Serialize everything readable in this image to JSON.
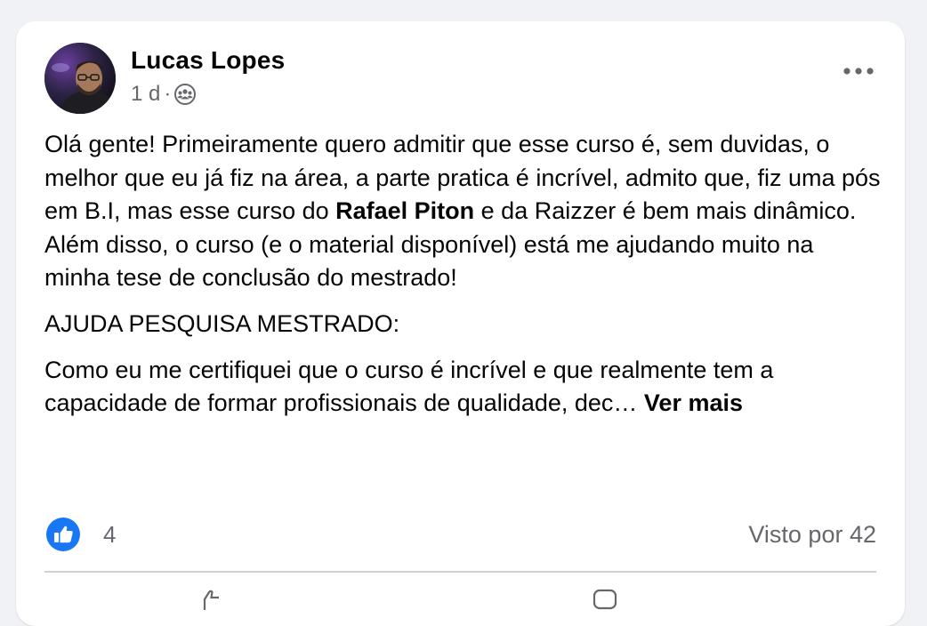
{
  "post": {
    "author": "Lucas Lopes",
    "time": "1 d",
    "separator": "·",
    "audience_icon": "group-audience-icon",
    "paragraph1": {
      "before": "Olá gente! Primeiramente quero admitir que esse curso é, sem duvidas, o melhor que eu já fiz na área, a parte pratica é incrível, admito que, fiz uma pós em B.I, mas esse curso do ",
      "bold": "Rafael Piton",
      "after": " e da Raizzer é bem mais dinâmico. Além disso, o curso (e o material disponível) está me ajudando muito na minha tese de conclusão do mestrado!"
    },
    "paragraph2": "AJUDA PESQUISA MESTRADO:",
    "paragraph3": "Como eu me certifiquei que o curso é incrível e que realmente tem a capacidade de formar profissionais de qualidade, dec… ",
    "see_more": "Ver mais",
    "reaction_count": "4",
    "seen_by": "Visto por 42"
  },
  "colors": {
    "like_blue": "#1877f2",
    "secondary_text": "#65676b",
    "primary_text": "#050505"
  }
}
